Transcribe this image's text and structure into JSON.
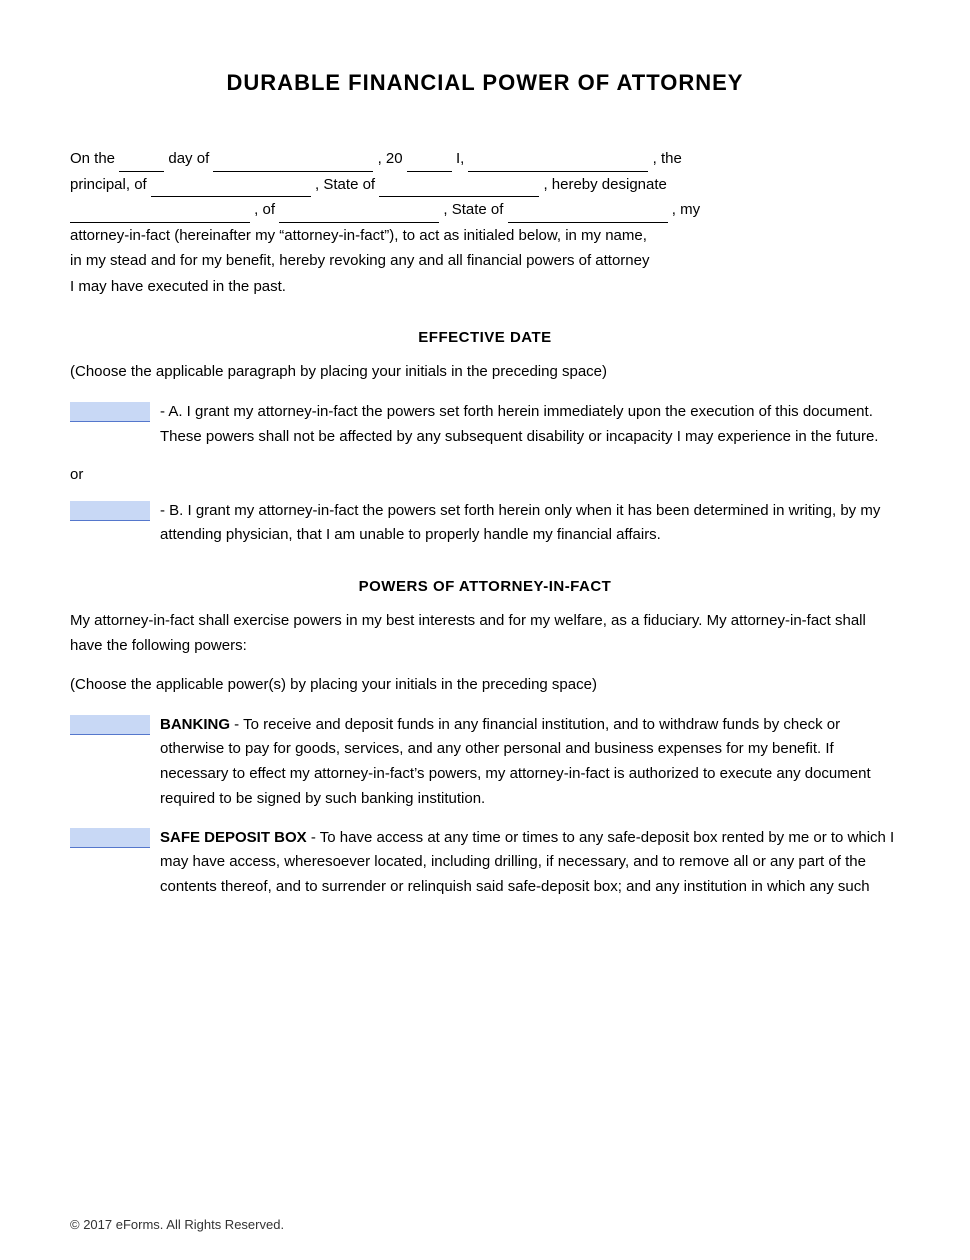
{
  "title": "DURABLE FINANCIAL POWER OF ATTORNEY",
  "intro": {
    "line1_pre": "On the",
    "line1_day": "",
    "line1_dayof": "day of",
    "line1_date": "",
    "line1_year_pre": ", 20",
    "line1_year": "",
    "line1_i": "I,",
    "line1_principal_name": "",
    "line1_the": ", the",
    "line2_principal_of": "principal, of",
    "line2_address": "",
    "line2_state_of": ", State of",
    "line2_state": "",
    "line2_hereby": ", hereby designate",
    "line3_name": "",
    "line3_of": ", of",
    "line3_address2": "",
    "line3_state_of2": ", State of",
    "line3_state2": "",
    "line3_my": ", my",
    "line4": "attorney-in-fact (hereinafter my “attorney-in-fact”), to act as initialed below, in my name,",
    "line5": "in my stead and for my benefit, hereby revoking any and all financial powers of attorney",
    "line6": "I may have executed in the past."
  },
  "effective_date": {
    "heading": "EFFECTIVE DATE",
    "choose_note": "(Choose the applicable paragraph by placing your initials in the preceding space)",
    "option_a": {
      "initials": "",
      "text": "- A. I grant my attorney-in-fact the powers set forth herein immediately upon the execution of this document. These powers shall not be affected by any subsequent disability or incapacity I may experience in the future."
    },
    "or": "or",
    "option_b": {
      "initials": "",
      "text": "- B. I grant my attorney-in-fact the powers set forth herein only when it has been determined in writing, by my attending physician, that I am unable to properly handle my financial affairs."
    }
  },
  "powers_of_attorney": {
    "heading": "POWERS OF ATTORNEY-IN-FACT",
    "intro1": "My attorney-in-fact shall exercise powers in my best interests and for my welfare, as a fiduciary. My attorney-in-fact shall have the following powers:",
    "choose_note": "(Choose the applicable power(s) by placing your initials in the preceding space)",
    "banking": {
      "initials": "",
      "label": "BANKING",
      "text": "- To receive and deposit funds in any financial institution, and to withdraw funds by check or otherwise to pay for goods, services, and any other personal and business expenses for my benefit.  If necessary to effect my attorney-in-fact’s powers, my attorney-in-fact is authorized to execute any document required to be signed by such banking institution."
    },
    "safe_deposit": {
      "initials": "",
      "label": "SAFE DEPOSIT BOX",
      "text": "- To have access at any time or times to any safe-deposit box rented by me or to which I may have access, wheresoever located, including drilling, if necessary, and to remove all or any part of the contents thereof, and to surrender or relinquish said safe-deposit box; and any institution in which any such"
    }
  },
  "footer": {
    "copyright": "© 2017 eForms. All Rights Reserved."
  }
}
